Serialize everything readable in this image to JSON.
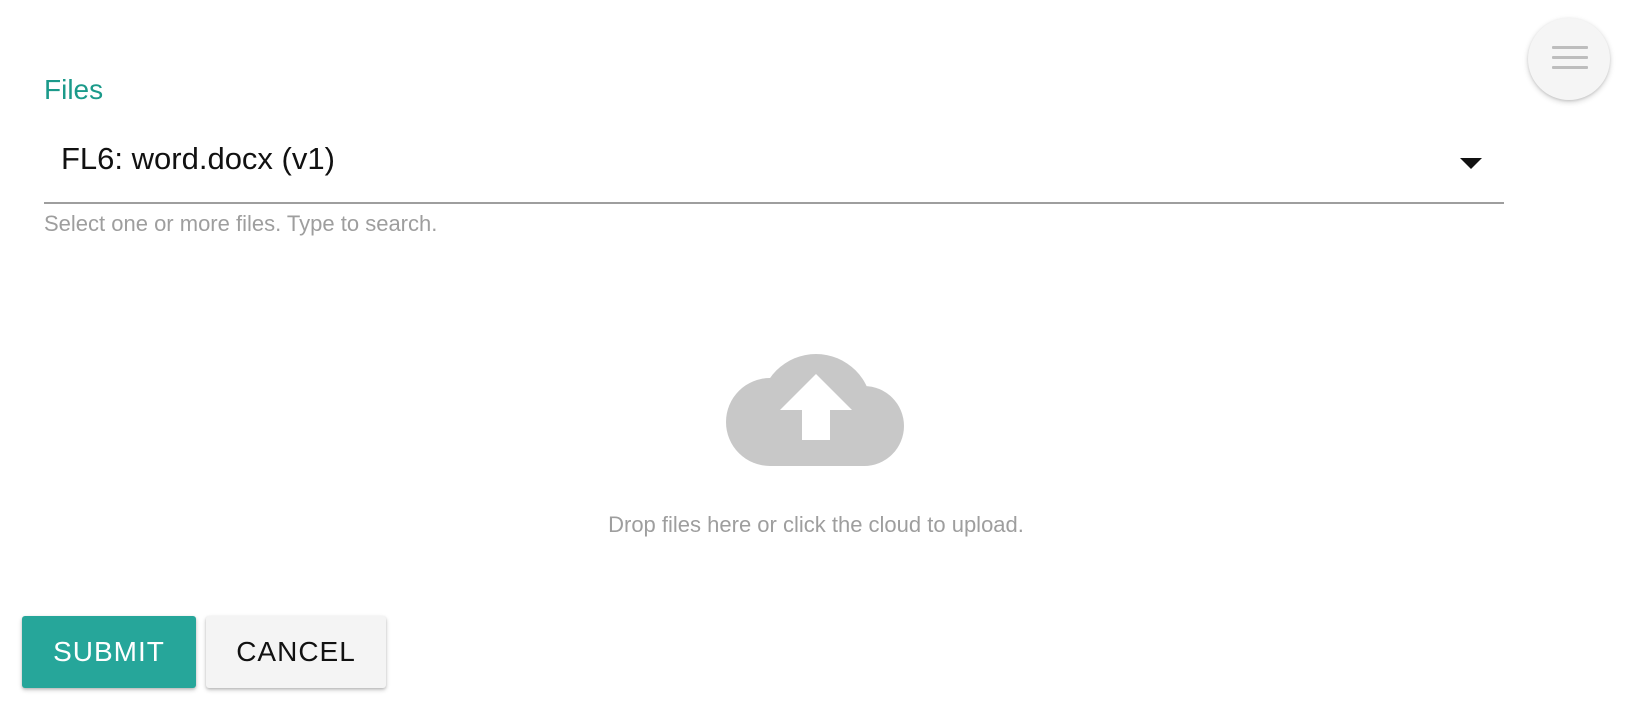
{
  "form": {
    "files_label": "Files",
    "selected_file": "FL6: word.docx (v1)",
    "helper_text": "Select one or more files. Type to search."
  },
  "upload": {
    "icon": "cloud-upload-icon",
    "drop_text": "Drop files here or click the cloud to upload."
  },
  "actions": {
    "submit_label": "SUBMIT",
    "cancel_label": "CANCEL"
  },
  "menu": {
    "icon": "hamburger-menu-icon"
  },
  "colors": {
    "accent": "#26a69a",
    "label_accent": "#1b9a8a",
    "muted_text": "#9e9e9e",
    "icon_gray": "#c8c8c8"
  }
}
